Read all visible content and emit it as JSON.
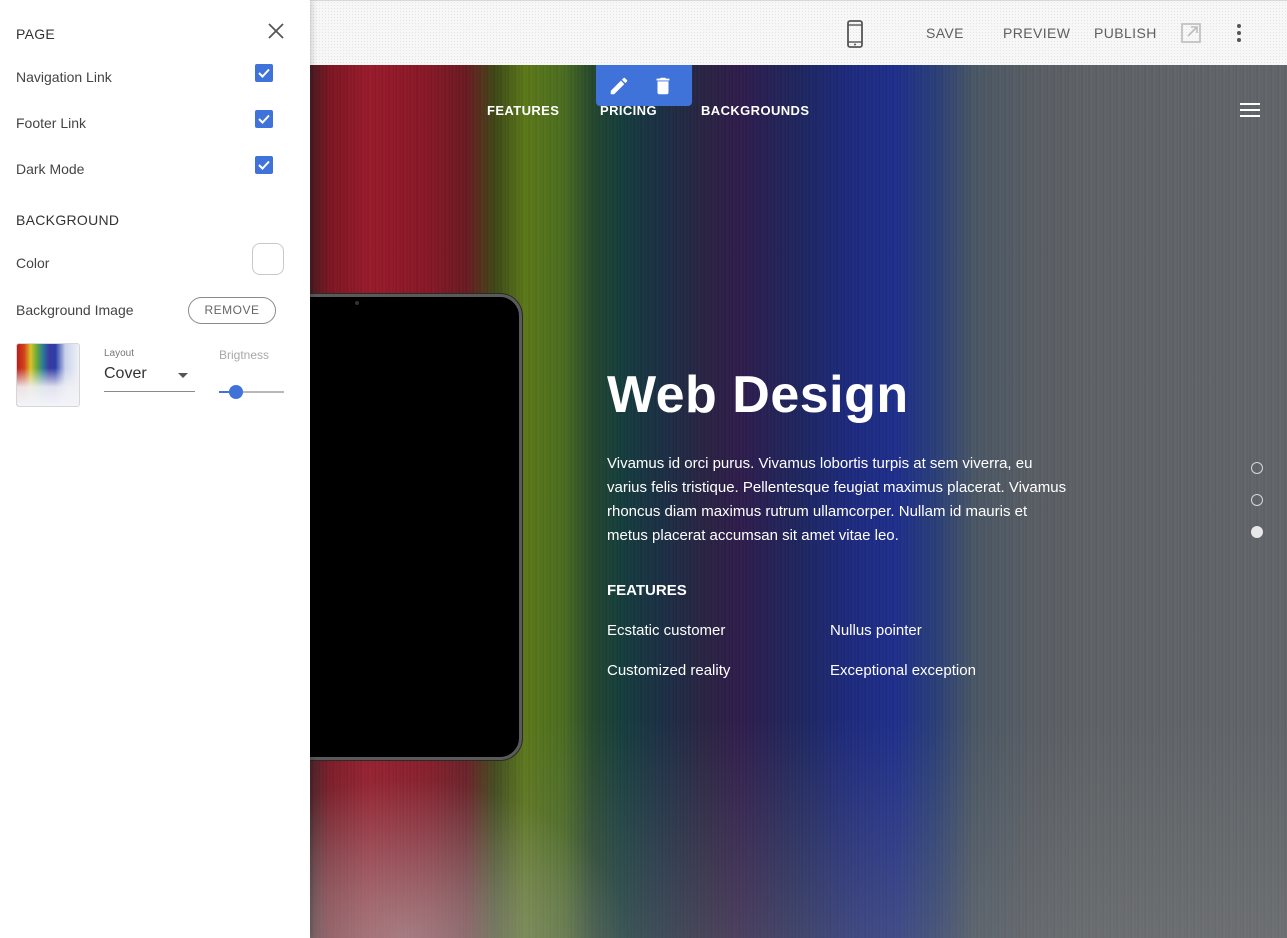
{
  "toolbar": {
    "save_label": "SAVE",
    "preview_label": "PREVIEW",
    "publish_label": "PUBLISH",
    "icons": [
      "phone-icon",
      "external-link-icon",
      "more-vert-icon"
    ]
  },
  "panel": {
    "page_heading": "PAGE",
    "toggles": [
      {
        "label": "Navigation Link",
        "checked": true
      },
      {
        "label": "Footer Link",
        "checked": true
      },
      {
        "label": "Dark Mode",
        "checked": true
      }
    ],
    "background_heading": "BACKGROUND",
    "color_label": "Color",
    "background_image_label": "Background Image",
    "remove_label": "REMOVE",
    "layout_label": "Layout",
    "layout_value": "Cover",
    "brightness_label": "Brigtness",
    "brightness_value": 0.2
  },
  "site": {
    "nav": [
      "FEATURES",
      "PRICING",
      "BACKGROUNDS"
    ],
    "hero_title": "Web Design",
    "hero_text": "Vivamus id orci purus. Vivamus lobortis turpis at sem viverra, eu varius felis tristique. Pellentesque feugiat maximus placerat. Vivamus rhoncus diam maximus rutrum ullamcorper. Nullam id mauris et metus placerat accumsan sit amet vitae leo.",
    "features_heading": "FEATURES",
    "features": [
      "Ecstatic customer",
      "Nullus pointer",
      "Customized reality",
      "Exceptional exception"
    ],
    "slide_count": 3,
    "active_slide": 3
  },
  "colors": {
    "accent": "#3f73d9",
    "toolbar_text": "#5f5f5f"
  }
}
